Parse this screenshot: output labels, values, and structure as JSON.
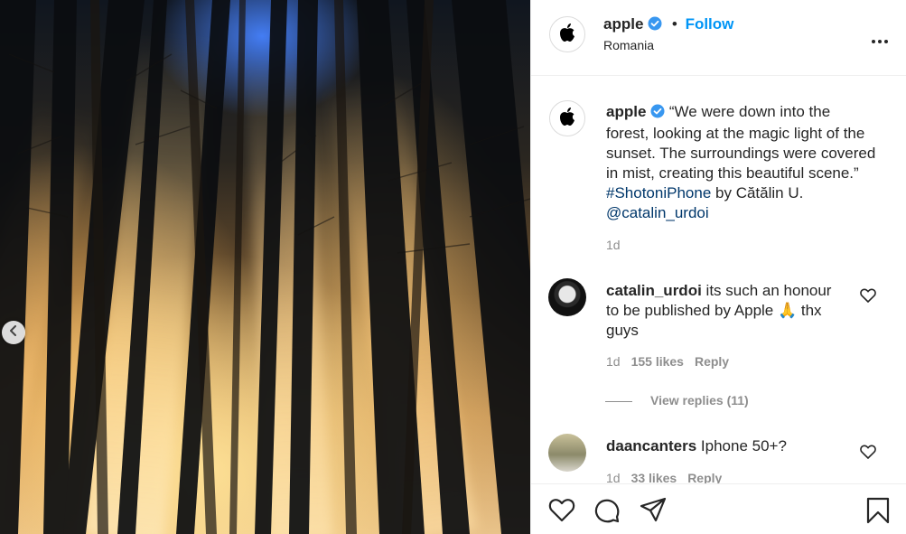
{
  "post": {
    "username": "apple",
    "follow_label": "Follow",
    "separator": "•",
    "location": "Romania"
  },
  "caption": {
    "username": "apple",
    "text": "“We were down into the forest, looking at the magic light of the sunset. The surroundings were covered in mist, creating this beautiful scene.”",
    "hashtag": "#ShotoniPhone",
    "by_text": "by Cătălin U.",
    "mention": "@catalin_urdoi",
    "time": "1d"
  },
  "comments": [
    {
      "username": "catalin_urdoi",
      "text": "its such an honour to be published by Apple 🙏 thx guys",
      "time": "1d",
      "likes": "155 likes",
      "reply_label": "Reply",
      "view_replies": "View replies (11)"
    },
    {
      "username": "daancanters",
      "text": "Iphone 50+?",
      "time": "1d",
      "likes": "33 likes",
      "reply_label": "Reply"
    }
  ],
  "icons": {
    "verified": "verified-badge-icon",
    "more": "more-options-icon",
    "like": "heart-icon",
    "comment": "comment-icon",
    "share": "share-icon",
    "save": "bookmark-icon",
    "carousel_prev": "chevron-left-icon",
    "logo": "apple-logo-icon"
  },
  "colors": {
    "link": "#0095f6",
    "hashtag": "#00376b",
    "muted": "#8e8e8e",
    "text": "#262626"
  }
}
